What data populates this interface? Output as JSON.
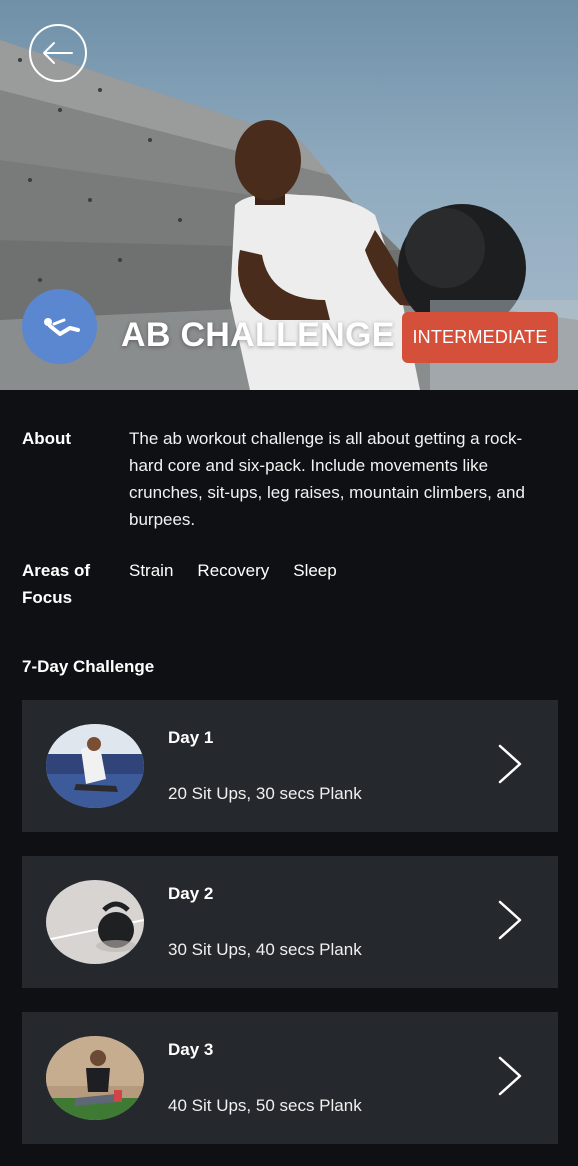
{
  "hero": {
    "title": "AB CHALLENGE",
    "level": "INTERMEDIATE",
    "back_icon": "arrow-left-icon",
    "category_icon": "situp-figure-icon",
    "colors": {
      "category_badge": "#5a87cf",
      "level_badge": "#d5503a"
    }
  },
  "about": {
    "label": "About",
    "text": "The ab workout challenge is all about getting a rock-hard core and six-pack. Include movements like crunches, sit-ups, leg raises, mountain climbers, and burpees."
  },
  "focus": {
    "label": "Areas of Focus",
    "items": [
      "Strain",
      "Recovery",
      "Sleep"
    ]
  },
  "challenge": {
    "title": "7-Day Challenge",
    "days": [
      {
        "title": "Day 1",
        "desc": "20 Sit Ups, 30 secs Plank"
      },
      {
        "title": "Day 2",
        "desc": "30 Sit Ups, 40 secs Plank"
      },
      {
        "title": "Day 3",
        "desc": "40 Sit Ups, 50 secs Plank"
      }
    ]
  },
  "colors": {
    "background": "#0f1013",
    "card": "#25282d"
  }
}
